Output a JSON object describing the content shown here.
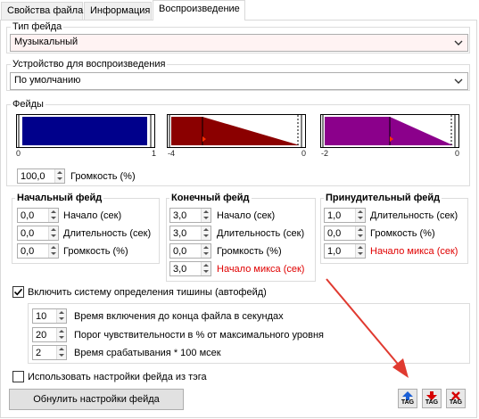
{
  "tabs": [
    {
      "label": "Свойства файла"
    },
    {
      "label": "Информация"
    },
    {
      "label": "Воспроизведение"
    }
  ],
  "fade_type": {
    "label": "Тип фейда",
    "value": "Музыкальный"
  },
  "device": {
    "label": "Устройство для воспроизведения",
    "value": "По умолчанию"
  },
  "fades": {
    "label": "Фейды",
    "graphs": [
      {
        "color": "#00008b",
        "min": "0",
        "max": "1"
      },
      {
        "color": "#8b0000",
        "min": "-4",
        "max": "0"
      },
      {
        "color": "#8b008b",
        "min": "-2",
        "max": "0"
      }
    ]
  },
  "volume": {
    "value": "100,0",
    "label": "Громкость (%)"
  },
  "start_fade": {
    "title": "Начальный фейд",
    "rows": [
      {
        "value": "0,0",
        "label": "Начало (сек)"
      },
      {
        "value": "0,0",
        "label": "Длительность (сек)"
      },
      {
        "value": "0,0",
        "label": "Громкость (%)"
      }
    ]
  },
  "end_fade": {
    "title": "Конечный фейд",
    "rows": [
      {
        "value": "3,0",
        "label": "Начало (сек)"
      },
      {
        "value": "3,0",
        "label": "Длительность (сек)"
      },
      {
        "value": "0,0",
        "label": "Громкость (%)"
      },
      {
        "value": "3,0",
        "label": "Начало микса (сек)"
      }
    ]
  },
  "forced_fade": {
    "title": "Принудительный фейд",
    "rows": [
      {
        "value": "1,0",
        "label": "Длительность (сек)"
      },
      {
        "value": "0,0",
        "label": "Громкость (%)"
      },
      {
        "value": "1,0",
        "label": "Начало микса (сек)"
      }
    ]
  },
  "silence": {
    "checkbox_label": "Включить систему определения тишины (автофейд)",
    "checked": true,
    "rows": [
      {
        "value": "10",
        "label": "Время включения до конца файла в секундах"
      },
      {
        "value": "20",
        "label": "Порог чувствительности в % от максимального уровня"
      },
      {
        "value": "2",
        "label": "Время срабатывания * 100 мсек"
      }
    ]
  },
  "use_tag": {
    "label": "Использовать настройки фейда из тэга",
    "checked": false
  },
  "reset_button": "Обнулить настройки фейда",
  "tag_buttons": [
    {
      "text": "TAG",
      "arrow": "up",
      "color": "#1a5fd6"
    },
    {
      "text": "TAG",
      "arrow": "down",
      "color": "#d60000"
    },
    {
      "text": "TAG",
      "arrow": "x",
      "color": "#d60000"
    }
  ],
  "colors": {
    "annotation_arrow": "#e03a30"
  }
}
